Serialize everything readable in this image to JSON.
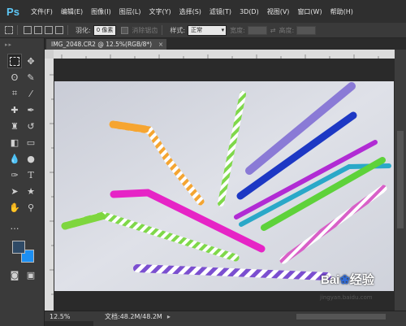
{
  "menubar": {
    "logo": "Ps",
    "items": [
      "文件(F)",
      "编辑(E)",
      "图像(I)",
      "图层(L)",
      "文字(Y)",
      "选择(S)",
      "滤镜(T)",
      "3D(D)",
      "视图(V)",
      "窗口(W)",
      "帮助(H)"
    ]
  },
  "options": {
    "feather_label": "羽化:",
    "feather_value": "0 像素",
    "antialias_label": "消除锯齿",
    "style_label": "样式:",
    "style_value": "正常",
    "width_label": "宽度:",
    "height_label": "高度:"
  },
  "document": {
    "tab_title": "IMG_2048.CR2 @ 12.5%(RGB/8*)",
    "close_glyph": "×"
  },
  "status": {
    "zoom": "12.5%",
    "doc_size": "文档:48.2M/48.2M"
  },
  "watermark": {
    "brand": "Bai",
    "brand_suffix": "经验",
    "url": "jingyan.baidu.com"
  },
  "colors": {
    "foreground": "#2f4a66",
    "background": "#1c8ff2"
  }
}
